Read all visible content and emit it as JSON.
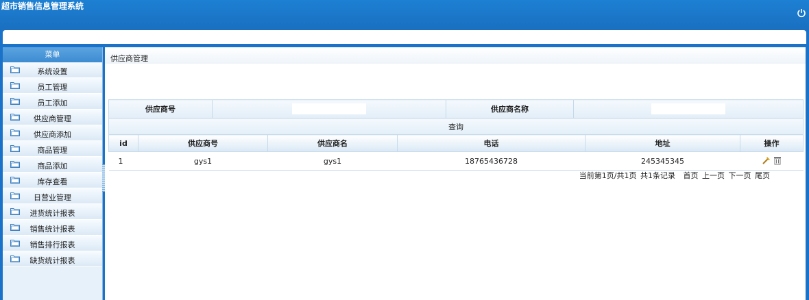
{
  "app_title": "超市销售信息管理系统",
  "sidebar": {
    "header": "菜单",
    "items": [
      {
        "label": "系统设置"
      },
      {
        "label": "员工管理"
      },
      {
        "label": "员工添加"
      },
      {
        "label": "供应商管理"
      },
      {
        "label": "供应商添加"
      },
      {
        "label": "商品管理"
      },
      {
        "label": "商品添加"
      },
      {
        "label": "库存查看"
      },
      {
        "label": "日营业管理"
      },
      {
        "label": "进货统计报表"
      },
      {
        "label": "销售统计报表"
      },
      {
        "label": "销售排行报表"
      },
      {
        "label": "缺货统计报表"
      }
    ]
  },
  "breadcrumb": "供应商管理",
  "search": {
    "label1": "供应商号",
    "value1": "",
    "label2": "供应商名称",
    "value2": "",
    "button": "查询"
  },
  "table": {
    "headers": [
      "id",
      "供应商号",
      "供应商名",
      "电话",
      "地址",
      "操作"
    ],
    "rows": [
      [
        "1",
        "gys1",
        "gys1",
        "18765436728",
        "245345345"
      ]
    ]
  },
  "pager": {
    "info": "当前第1页/共1页",
    "count": "共1条记录",
    "first": "首页",
    "prev": "上一页",
    "next": "下一页",
    "last": "尾页"
  }
}
